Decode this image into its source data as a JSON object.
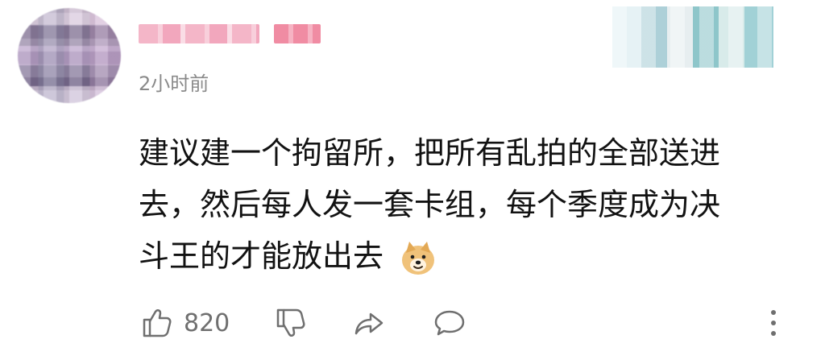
{
  "comment": {
    "time": "2小时前",
    "text_lines": [
      "建议建一个拘留所，把所有乱拍的全部送进",
      "去，然后每人发一套卡组，每个季度成为决",
      "斗王的才能放出去"
    ],
    "emoji": "doge-emoji"
  },
  "actions": {
    "like_count": "820",
    "icons": [
      "thumbs-up-icon",
      "thumbs-down-icon",
      "share-icon",
      "reply-icon",
      "more-icon"
    ]
  }
}
